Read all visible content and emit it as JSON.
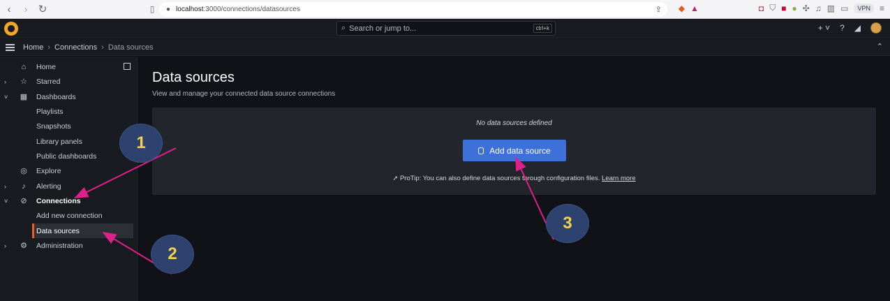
{
  "browser": {
    "url_host": "localhost",
    "url_rest": ":3000/connections/datasources",
    "vpn_label": "VPN"
  },
  "topbar": {
    "search_placeholder": "Search or jump to...",
    "search_shortcut": "ctrl+k"
  },
  "breadcrumb": [
    "Home",
    "Connections",
    "Data sources"
  ],
  "sidebar": {
    "items": [
      {
        "label": "Home",
        "icon": "home-icon"
      },
      {
        "label": "Starred",
        "icon": "star-icon"
      },
      {
        "label": "Dashboards",
        "icon": "grid-icon"
      },
      {
        "label": "Playlists"
      },
      {
        "label": "Snapshots"
      },
      {
        "label": "Library panels"
      },
      {
        "label": "Public dashboards"
      },
      {
        "label": "Explore",
        "icon": "compass-icon"
      },
      {
        "label": "Alerting",
        "icon": "bell-icon"
      },
      {
        "label": "Connections",
        "icon": "connections-icon"
      },
      {
        "label": "Add new connection"
      },
      {
        "label": "Data sources"
      },
      {
        "label": "Administration",
        "icon": "gear-icon"
      }
    ]
  },
  "main": {
    "title": "Data sources",
    "subtitle": "View and manage your connected data source connections",
    "empty_message": "No data sources defined",
    "add_button": "Add data source",
    "protip_text": "ProTip: You can also define data sources through configuration files.",
    "protip_link": "Learn more"
  },
  "annotations": {
    "badge_1": "1",
    "badge_2": "2",
    "badge_3": "3",
    "arrow_color": "#e0208a"
  }
}
